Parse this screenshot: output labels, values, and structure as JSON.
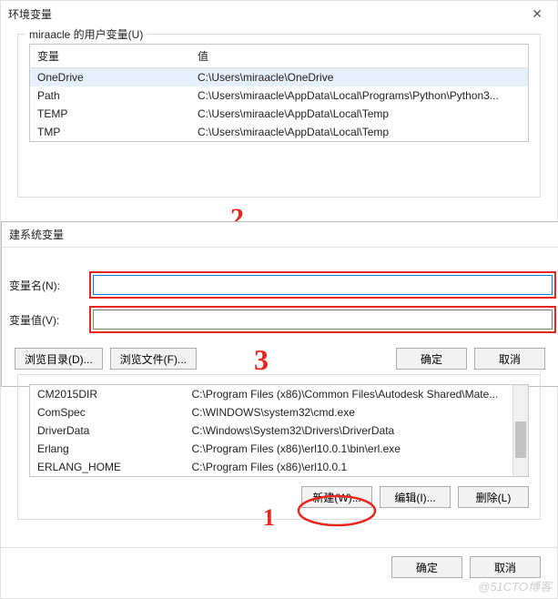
{
  "window": {
    "title": "环境变量"
  },
  "user_vars": {
    "legend": "miraacle 的用户变量(U)",
    "columns": {
      "name": "变量",
      "value": "值"
    },
    "rows": [
      {
        "name": "OneDrive",
        "value": "C:\\Users\\miraacle\\OneDrive"
      },
      {
        "name": "Path",
        "value": "C:\\Users\\miraacle\\AppData\\Local\\Programs\\Python\\Python3..."
      },
      {
        "name": "TEMP",
        "value": "C:\\Users\\miraacle\\AppData\\Local\\Temp"
      },
      {
        "name": "TMP",
        "value": "C:\\Users\\miraacle\\AppData\\Local\\Temp"
      }
    ]
  },
  "new_var_dialog": {
    "title": "建系统变量",
    "name_label": "变量名(N):",
    "value_label": "变量值(V):",
    "name_value": "",
    "value_value": "",
    "browse_dir": "浏览目录(D)...",
    "browse_file": "浏览文件(F)...",
    "ok": "确定",
    "cancel": "取消"
  },
  "sys_vars": {
    "rows": [
      {
        "name": "CM2015DIR",
        "value": "C:\\Program Files (x86)\\Common Files\\Autodesk Shared\\Mate..."
      },
      {
        "name": "ComSpec",
        "value": "C:\\WINDOWS\\system32\\cmd.exe"
      },
      {
        "name": "DriverData",
        "value": "C:\\Windows\\System32\\Drivers\\DriverData"
      },
      {
        "name": "Erlang",
        "value": "C:\\Program Files (x86)\\erl10.0.1\\bin\\erl.exe"
      },
      {
        "name": "ERLANG_HOME",
        "value": "C:\\Program Files (x86)\\erl10.0.1"
      }
    ],
    "buttons": {
      "new": "新建(W)...",
      "edit": "编辑(I)...",
      "delete": "删除(L)"
    }
  },
  "outer_buttons": {
    "ok": "确定",
    "cancel": "取消"
  },
  "annotations": {
    "one": "1",
    "two": "2",
    "three": "3"
  },
  "watermark": "@51CTO博客"
}
